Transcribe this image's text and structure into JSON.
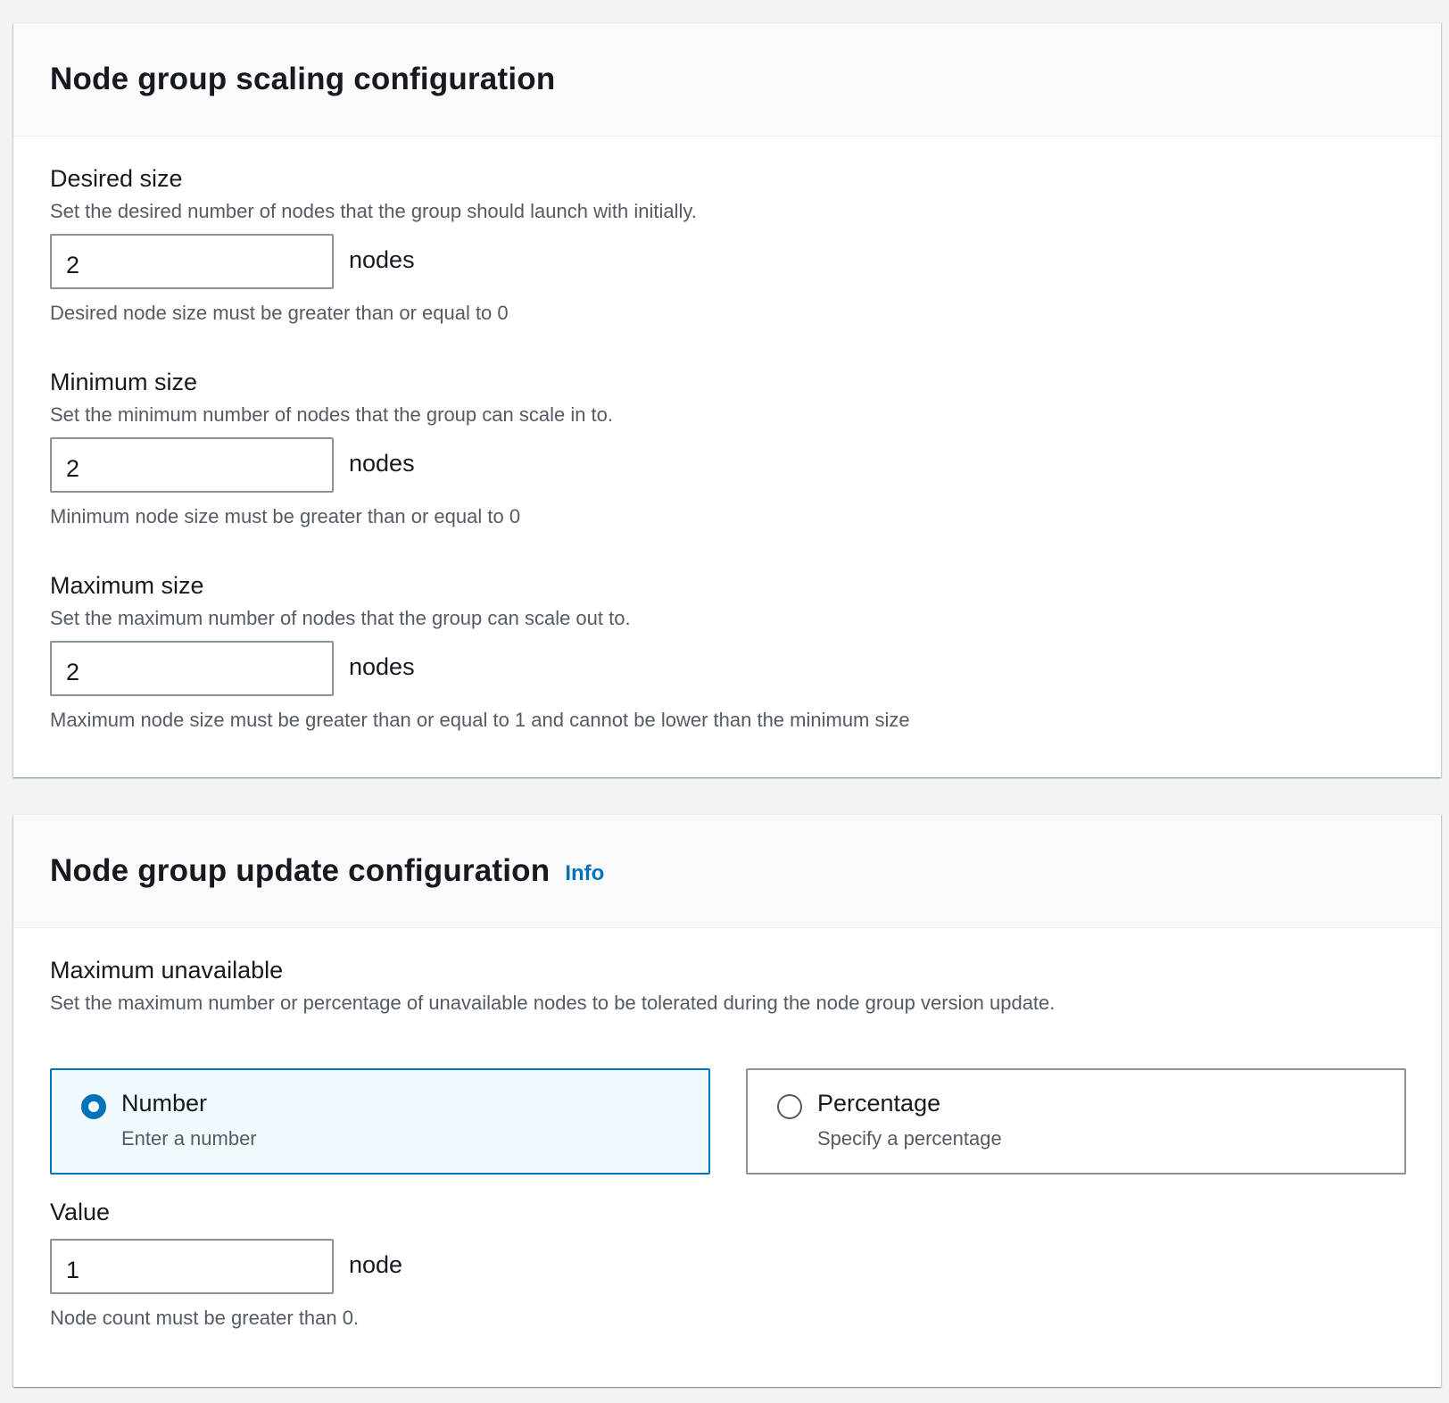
{
  "scaling": {
    "title": "Node group scaling configuration",
    "desired": {
      "label": "Desired size",
      "description": "Set the desired number of nodes that the group should launch with initially.",
      "value": "2",
      "unit": "nodes",
      "constraint": "Desired node size must be greater than or equal to 0"
    },
    "minimum": {
      "label": "Minimum size",
      "description": "Set the minimum number of nodes that the group can scale in to.",
      "value": "2",
      "unit": "nodes",
      "constraint": "Minimum node size must be greater than or equal to 0"
    },
    "maximum": {
      "label": "Maximum size",
      "description": "Set the maximum number of nodes that the group can scale out to.",
      "value": "2",
      "unit": "nodes",
      "constraint": "Maximum node size must be greater than or equal to 1 and cannot be lower than the minimum size"
    }
  },
  "update": {
    "title": "Node group update configuration",
    "info_label": "Info",
    "max_unavailable": {
      "label": "Maximum unavailable",
      "description": "Set the maximum number or percentage of unavailable nodes to be tolerated during the node group version update.",
      "options": [
        {
          "label": "Number",
          "description": "Enter a number",
          "selected": true
        },
        {
          "label": "Percentage",
          "description": "Specify a percentage",
          "selected": false
        }
      ]
    },
    "value": {
      "label": "Value",
      "value": "1",
      "unit": "node",
      "constraint": "Node count must be greater than 0."
    }
  },
  "colors": {
    "accent": "#0073bb",
    "selected_tile_bg": "#f1faff",
    "page_bg": "#f2f3f3",
    "secondary_text": "#545b64"
  }
}
